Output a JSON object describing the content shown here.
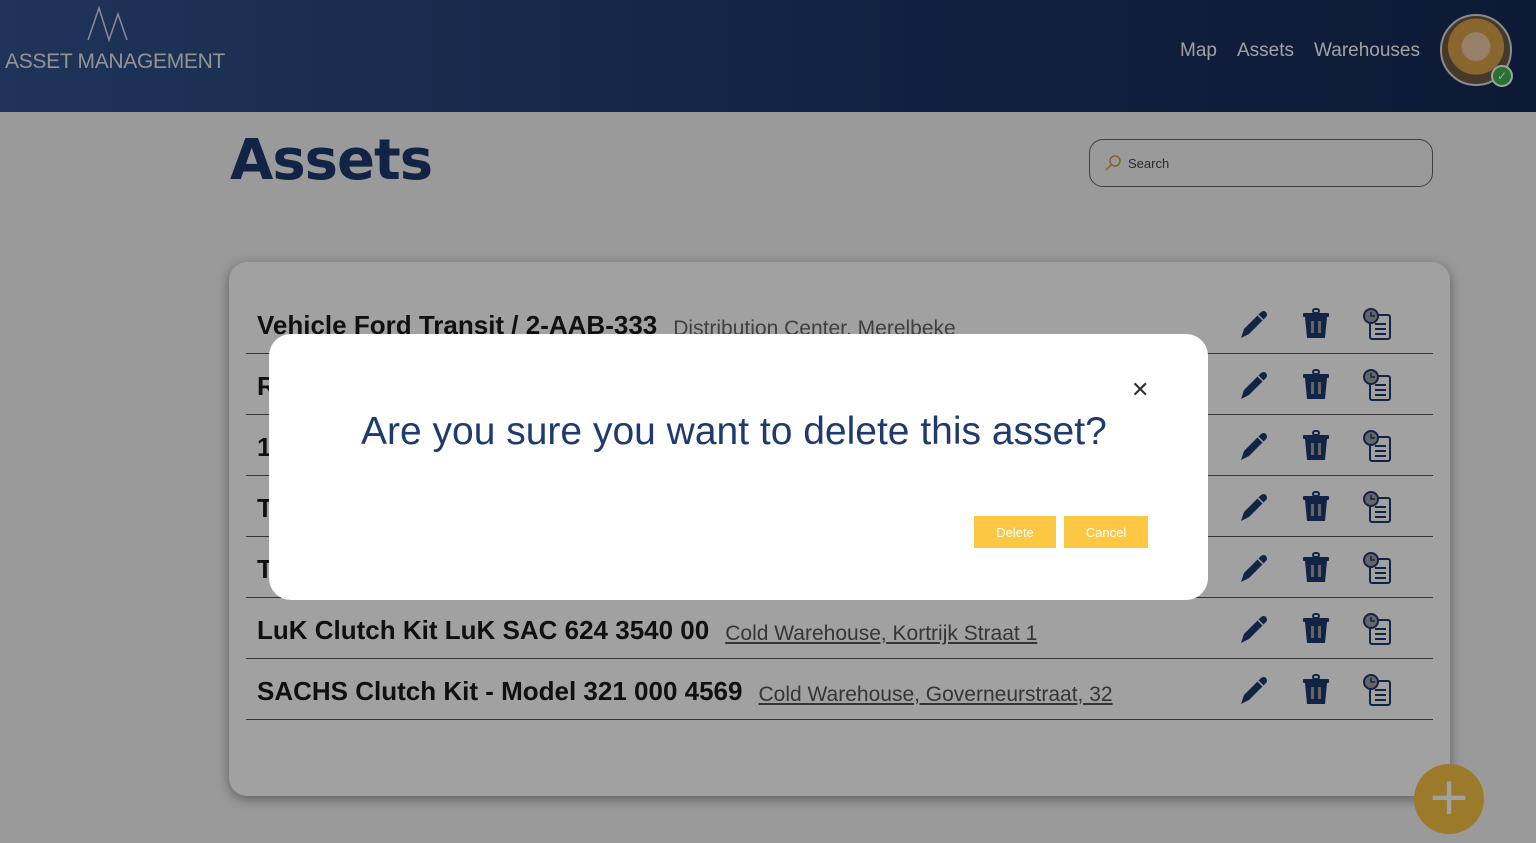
{
  "header": {
    "logo_text": "ASSET MANAGEMENT",
    "nav": [
      "Map",
      "Assets",
      "Warehouses"
    ]
  },
  "page": {
    "title": "Assets",
    "search_placeholder": "Search"
  },
  "assets": [
    {
      "name": "Vehicle Ford Transit / 2-AAB-333",
      "location": "Distribution Center, Merelbeke",
      "link": false
    },
    {
      "name": "R",
      "location": "",
      "link": false
    },
    {
      "name": "1",
      "location": "",
      "link": false
    },
    {
      "name": "T",
      "location": "",
      "link": false
    },
    {
      "name": "T",
      "location": "",
      "link": false
    },
    {
      "name": "LuK Clutch Kit LuK SAC 624 3540 00",
      "location": "Cold Warehouse, Kortrijk Straat 1",
      "link": true
    },
    {
      "name": "SACHS Clutch Kit - Model 321 000 4569",
      "location": "Cold Warehouse, Governeurstraat, 32",
      "link": true
    }
  ],
  "modal": {
    "question": "Are you sure you want to delete this asset?",
    "delete_label": "Delete",
    "cancel_label": "Cancel",
    "close": "✕"
  },
  "fab": "+"
}
